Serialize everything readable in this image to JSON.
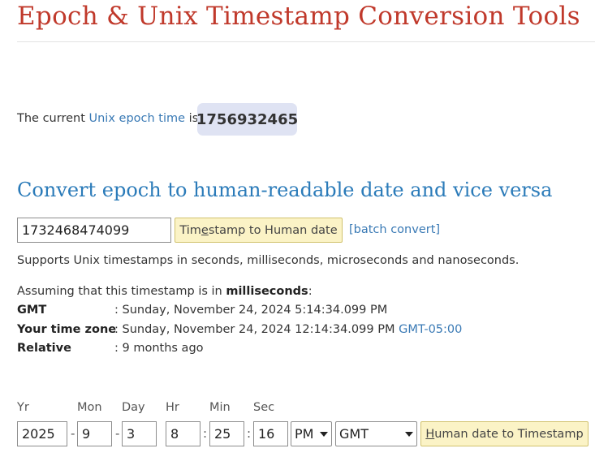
{
  "title": "Epoch & Unix Timestamp Conversion Tools",
  "current": {
    "prefix": "The current",
    "link": "Unix epoch time",
    "suffix": "is",
    "value": "1756932465"
  },
  "convert": {
    "heading": "Convert epoch to human-readable date and vice versa",
    "input_value": "1732468474099",
    "button_pre": "Tim",
    "button_underline": "e",
    "button_post": "stamp to Human date",
    "batch_link": "[batch convert]",
    "supports_text": "Supports Unix timestamps in seconds, milliseconds, microseconds and nanoseconds."
  },
  "result": {
    "assuming_prefix": "Assuming that this timestamp is in",
    "assuming_unit": "milliseconds",
    "assuming_suffix": ":",
    "rows": [
      {
        "label": "GMT",
        "value": ": Sunday, November 24, 2024 5:14:34.099 PM",
        "extra": ""
      },
      {
        "label": "Your time zone",
        "value": ": Sunday, November 24, 2024 12:14:34.099 PM",
        "extra": "GMT-05:00"
      },
      {
        "label": "Relative",
        "value": ": 9 months ago",
        "extra": ""
      }
    ]
  },
  "human_date": {
    "labels": {
      "yr": "Yr",
      "mon": "Mon",
      "day": "Day",
      "hr": "Hr",
      "min": "Min",
      "sec": "Sec"
    },
    "values": {
      "yr": "2025",
      "mon": "9",
      "day": "3",
      "hr": "8",
      "min": "25",
      "sec": "16"
    },
    "date_sep": "-",
    "time_sep": ":",
    "ampm": "PM",
    "timezone": "GMT",
    "button_underline": "H",
    "button_post": "uman date to Timestamp"
  },
  "colors": {
    "title": "#c0392b",
    "heading": "#2b7bb9",
    "link": "#3a7ab5",
    "button_bg": "#fbf3c6",
    "epoch_bg": "#dfe3f3"
  }
}
